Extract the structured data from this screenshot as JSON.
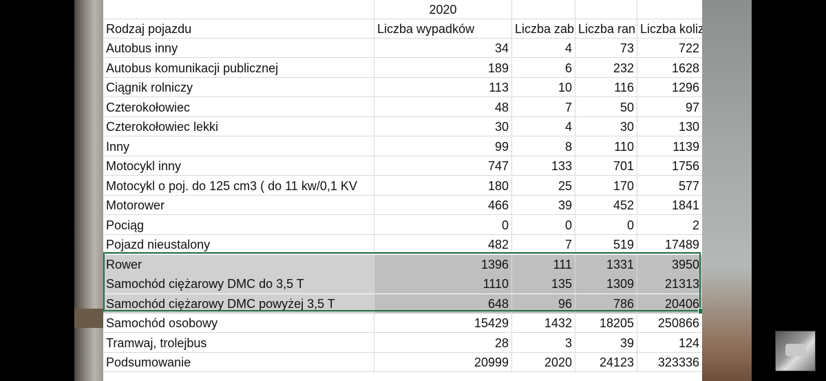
{
  "sheet": {
    "year": "2020",
    "headers": [
      "Rodzaj pojazdu",
      "Liczba wypadków",
      "Liczba zab",
      "Liczba ran",
      "Liczba kolizji"
    ],
    "rows": [
      [
        "Autobus inny",
        "34",
        "4",
        "73",
        "722"
      ],
      [
        "Autobus komunikacji publicznej",
        "189",
        "6",
        "232",
        "1628"
      ],
      [
        "Ciągnik rolniczy",
        "113",
        "10",
        "116",
        "1296"
      ],
      [
        "Czterokołowiec",
        "48",
        "7",
        "50",
        "97"
      ],
      [
        "Czterokołowiec lekki",
        "30",
        "4",
        "30",
        "130"
      ],
      [
        "Inny",
        "99",
        "8",
        "110",
        "1139"
      ],
      [
        "Motocykl inny",
        "747",
        "133",
        "701",
        "1756"
      ],
      [
        "Motocykl o poj. do 125 cm3 ( do 11 kw/0,1 KV",
        "180",
        "25",
        "170",
        "577"
      ],
      [
        "Motorower",
        "466",
        "39",
        "452",
        "1841"
      ],
      [
        "Pociąg",
        "0",
        "0",
        "0",
        "2"
      ],
      [
        "Pojazd nieustalony",
        "482",
        "7",
        "519",
        "17489"
      ],
      [
        "Rower",
        "1396",
        "111",
        "1331",
        "3950"
      ],
      [
        "Samochód ciężarowy DMC do 3,5 T",
        "1110",
        "135",
        "1309",
        "21313"
      ],
      [
        "Samochód ciężarowy DMC powyżej 3,5 T",
        "648",
        "96",
        "786",
        "20406"
      ],
      [
        "Samochód osobowy",
        "15429",
        "1432",
        "18205",
        "250866"
      ],
      [
        "Tramwaj, trolejbus",
        "28",
        "3",
        "39",
        "124"
      ],
      [
        "Podsumowanie",
        "20999",
        "2020",
        "24123",
        "323336"
      ]
    ],
    "selected_rows": [
      "Rower",
      "Samochód ciężarowy DMC do 3,5 T",
      "Samochód ciężarowy DMC powyżej 3,5 T"
    ],
    "selection_color": "#217346",
    "selection_fill": "#bfbfbf"
  }
}
